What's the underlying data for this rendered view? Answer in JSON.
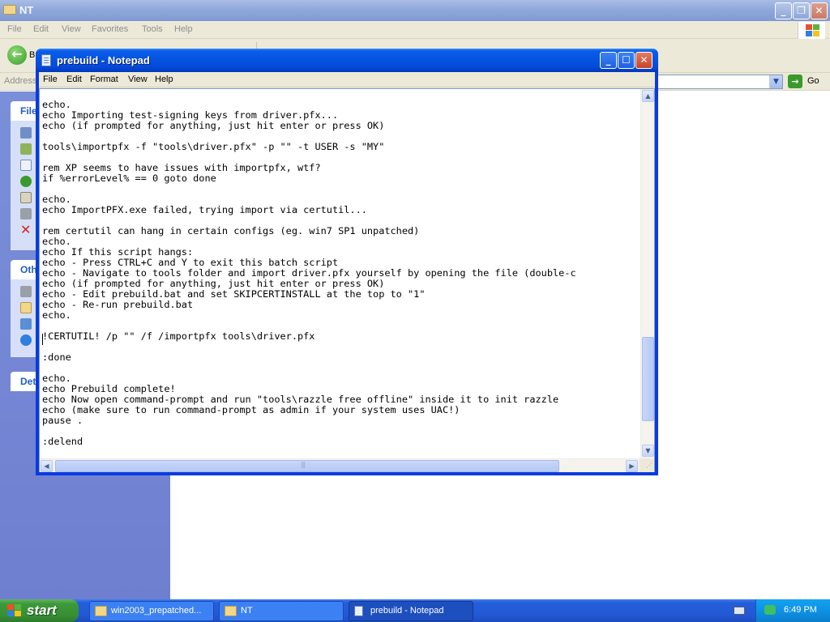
{
  "explorer": {
    "title": "NT",
    "menu": [
      "File",
      "Edit",
      "View",
      "Favorites",
      "Tools",
      "Help"
    ],
    "back_label": "B",
    "address_label": "Address",
    "go_label": "Go",
    "taskpane": {
      "file_head": "File",
      "other_head": "Oth",
      "details_head": "Det"
    }
  },
  "notepad": {
    "title": "prebuild - Notepad",
    "menu": [
      "File",
      "Edit",
      "Format",
      "View",
      "Help"
    ],
    "lines": [
      "echo.",
      "echo Importing test-signing keys from driver.pfx...",
      "echo (if prompted for anything, just hit enter or press OK)",
      "",
      "tools\\importpfx -f \"tools\\driver.pfx\" -p \"\" -t USER -s \"MY\"",
      "",
      "rem XP seems to have issues with importpfx, wtf?",
      "if %errorLevel% == 0 goto done",
      "",
      "echo.",
      "echo ImportPFX.exe failed, trying import via certutil...",
      "",
      "rem certutil can hang in certain configs (eg. win7 SP1 unpatched)",
      "echo.",
      "echo If this script hangs:",
      "echo - Press CTRL+C and Y to exit this batch script",
      "echo - Navigate to tools folder and import driver.pfx yourself by opening the file (double-c",
      "echo (if prompted for anything, just hit enter or press OK)",
      "echo - Edit prebuild.bat and set SKIPCERTINSTALL at the top to \"1\"",
      "echo - Re-run prebuild.bat",
      "echo.",
      "",
      "!CERTUTIL! /p \"\" /f /importpfx tools\\driver.pfx",
      "",
      ":done",
      "",
      "echo.",
      "echo Prebuild complete!",
      "echo Now open command-prompt and run \"tools\\razzle free offline\" inside it to init razzle",
      "echo (make sure to run command-prompt as admin if your system uses UAC!)",
      "pause .",
      "",
      ":delend"
    ]
  },
  "taskbar": {
    "start_label": "start",
    "tasks": [
      {
        "label": "win2003_prepatched...",
        "icon": "folder-icon"
      },
      {
        "label": "NT",
        "icon": "folder-icon"
      },
      {
        "label": "prebuild - Notepad",
        "icon": "notepad-icon"
      }
    ],
    "clock": "6:49 PM"
  },
  "colors": {
    "xp_blue": "#0554e3",
    "taskbar_blue": "#245edb",
    "start_green": "#3c9a39",
    "close_red": "#c8432a",
    "taskpane_blue": "#7a8fd9"
  }
}
